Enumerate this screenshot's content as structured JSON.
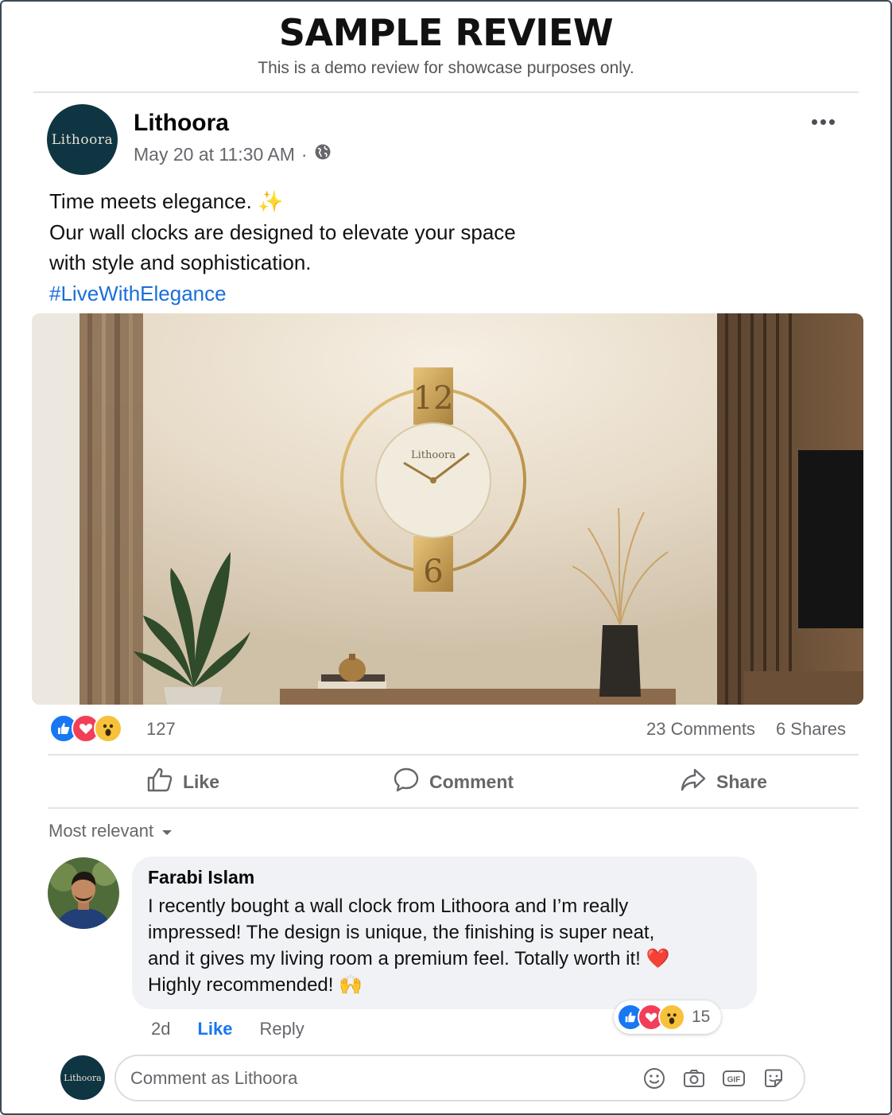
{
  "banner": {
    "title": "SAMPLE REVIEW",
    "subtitle": "This is a demo review for showcase purposes only."
  },
  "post": {
    "page_name": "Lithoora",
    "avatar_text": "Lithoora",
    "timestamp": "May 20 at 11:30 AM",
    "separator": "·",
    "audience_icon": "globe-icon",
    "more_icon": "more-horizontal-icon",
    "text_lines": [
      "Time meets elegance. ✨",
      "Our wall clocks are designed to elevate your space",
      "with style and sophistication."
    ],
    "hashtag": "#LiveWithElegance",
    "image": {
      "clock_top_numeral": "12",
      "clock_bottom_numeral": "6",
      "clock_brand": "Lithoora"
    }
  },
  "stats": {
    "reaction_icons": [
      "like-reaction-icon",
      "love-reaction-icon",
      "wow-reaction-icon"
    ],
    "reaction_count": "127",
    "comments": "23 Comments",
    "shares": "6 Shares"
  },
  "actions": {
    "like": "Like",
    "comment": "Comment",
    "share": "Share"
  },
  "comments_section": {
    "sort_label": "Most relevant",
    "comment": {
      "author": "Farabi Islam",
      "lines": [
        "I recently bought a wall clock from Lithoora and I’m really",
        "impressed! The design is unique, the finishing is super neat,",
        "and it gives my living room a premium feel. Totally worth it! ❤️",
        "Highly recommended! 🙌"
      ],
      "reaction_count": "15",
      "age": "2d",
      "like": "Like",
      "reply": "Reply"
    },
    "composer": {
      "avatar_text": "Lithoora",
      "placeholder": "Comment as Lithoora",
      "icons": [
        "emoji-icon",
        "camera-icon",
        "gif-icon",
        "sticker-icon"
      ]
    }
  },
  "colors": {
    "brand_blue": "#1877f2",
    "avatar_bg": "#0f3543",
    "muted_text": "#65676b",
    "bubble_bg": "#f0f2f5"
  }
}
